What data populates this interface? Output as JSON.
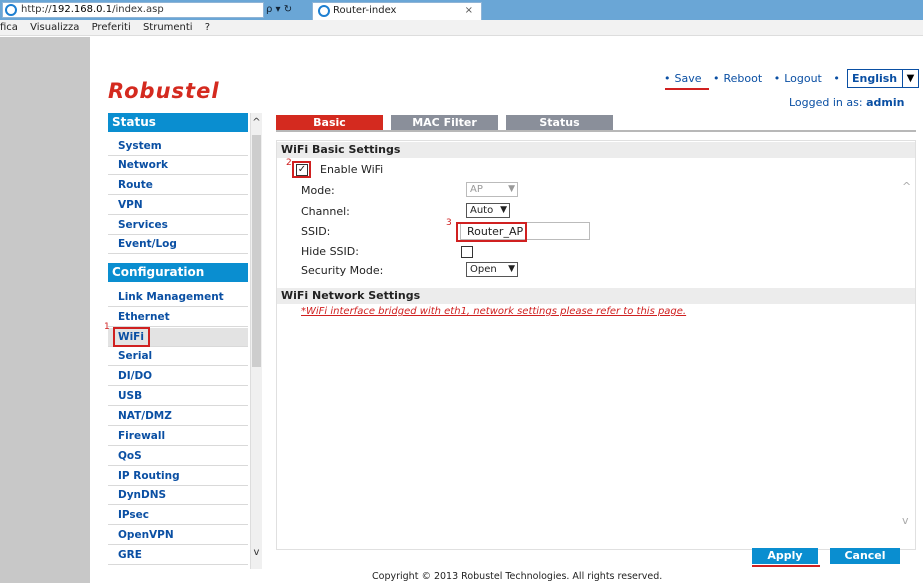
{
  "browser": {
    "address": "http://192.168.0.1/index.asp",
    "address_prefix": "http://",
    "address_host": "192.168.0.1",
    "address_path": "/index.asp",
    "address_controls": "ρ ▾ ↻",
    "tab_title": "Router-index",
    "tab_close": "×",
    "menu": [
      "fica",
      "Visualizza",
      "Preferiti",
      "Strumenti",
      "?"
    ]
  },
  "header": {
    "logo": "Robustel",
    "nav": [
      "Save",
      "Reboot",
      "Logout"
    ],
    "language": "English",
    "logged_prefix": "Logged in as:",
    "logged_user": "admin"
  },
  "sidebar": {
    "status_title": "Status",
    "status_items": [
      "System",
      "Network",
      "Route",
      "VPN",
      "Services",
      "Event/Log"
    ],
    "config_title": "Configuration",
    "config_items": [
      "Link Management",
      "Ethernet",
      "WiFi",
      "Serial",
      "DI/DO",
      "USB",
      "NAT/DMZ",
      "Firewall",
      "QoS",
      "IP Routing",
      "DynDNS",
      "IPsec",
      "OpenVPN",
      "GRE"
    ],
    "active_item": "WiFi"
  },
  "tabs": [
    "Basic",
    "MAC Filter",
    "Status"
  ],
  "wifi_basic": {
    "title": "WiFi Basic Settings",
    "enable_label": "Enable WiFi",
    "mode_label": "Mode:",
    "mode_value": "AP",
    "channel_label": "Channel:",
    "channel_value": "Auto",
    "ssid_label": "SSID:",
    "ssid_value": "Router_AP",
    "hide_ssid_label": "Hide SSID:",
    "security_label": "Security Mode:",
    "security_value": "Open"
  },
  "wifi_network": {
    "title": "WiFi Network Settings",
    "note": "*WiFi interface bridged with eth1, network settings please refer to this page."
  },
  "annotations": [
    "1",
    "2",
    "3"
  ],
  "buttons": {
    "apply": "Apply",
    "cancel": "Cancel"
  },
  "footer": {
    "copyright": "Copyright © 2013 Robustel Technologies. All rights reserved."
  },
  "colors": {
    "brand_red": "#d42a1f",
    "accent_blue": "#0a8ed0",
    "link_blue": "#0a4fa3",
    "annotation_red": "#d02020"
  }
}
